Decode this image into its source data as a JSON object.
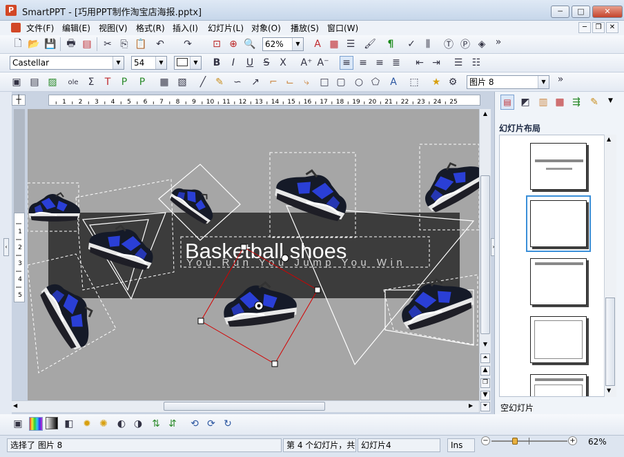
{
  "window": {
    "app_name": "SmartPPT",
    "title": "SmartPPT - [巧用PPT制作淘宝店海报.pptx]",
    "min": "─",
    "max": "□",
    "close": "✕"
  },
  "menu": [
    "文件(F)",
    "编辑(E)",
    "视图(V)",
    "格式(R)",
    "插入(I)",
    "幻灯片(L)",
    "对象(O)",
    "播放(S)",
    "窗口(W)"
  ],
  "toolbar1": {
    "zoom": "62%"
  },
  "format_bar": {
    "font_name": "Castellar",
    "font_size": "54"
  },
  "draw_bar": {
    "object_select": "图片 8"
  },
  "ruler": {
    "h_ticks": [
      "1",
      "2",
      "3",
      "4",
      "5",
      "6",
      "7",
      "8",
      "9",
      "10",
      "11",
      "12",
      "13",
      "14",
      "15",
      "16",
      "17",
      "18",
      "19",
      "20",
      "21",
      "22",
      "23",
      "24",
      "25"
    ],
    "v_ticks": [
      "1",
      "2",
      "3",
      "4",
      "5"
    ]
  },
  "slide": {
    "title": "Basketball shoes",
    "subtitle": "You Run You Jump You Win"
  },
  "right_panel": {
    "heading": "幻灯片布局",
    "selected_layout": "空幻灯片"
  },
  "status": {
    "selection": "选择了 图片 8",
    "slide_pos": "第 4 个幻灯片，共",
    "slide_name": "幻灯片4",
    "mode": "Ins",
    "zoom": "62%"
  },
  "colors": {
    "band": "#3c3c3c",
    "canvas": "#a6a6a6",
    "selection": "#d40000",
    "shoe_blue": "#2a3fd6"
  }
}
